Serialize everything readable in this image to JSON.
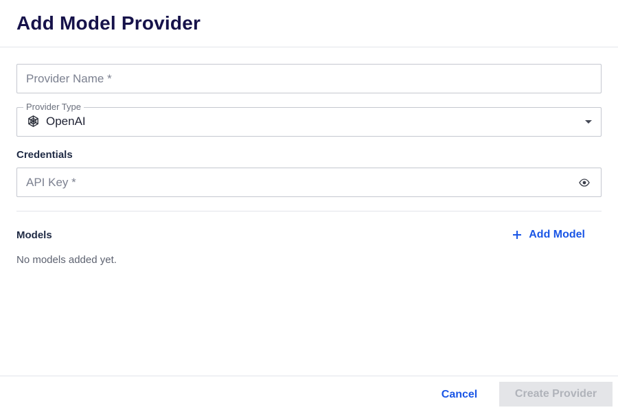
{
  "dialog": {
    "title": "Add Model Provider"
  },
  "provider_name": {
    "placeholder": "Provider Name *",
    "value": ""
  },
  "provider_type": {
    "label": "Provider Type",
    "selected": "OpenAI",
    "icon": "openai-icon"
  },
  "credentials": {
    "section_label": "Credentials",
    "api_key_placeholder": "API Key *",
    "toggle_icon": "eye-icon"
  },
  "models": {
    "section_label": "Models",
    "add_label": "Add Model",
    "empty_message": "No models added yet."
  },
  "footer": {
    "cancel_label": "Cancel",
    "create_label": "Create Provider"
  },
  "colors": {
    "accent": "#1a56e6",
    "title": "#16124a",
    "disabled_bg": "#e4e5e8",
    "disabled_text": "#b0b3ba"
  }
}
